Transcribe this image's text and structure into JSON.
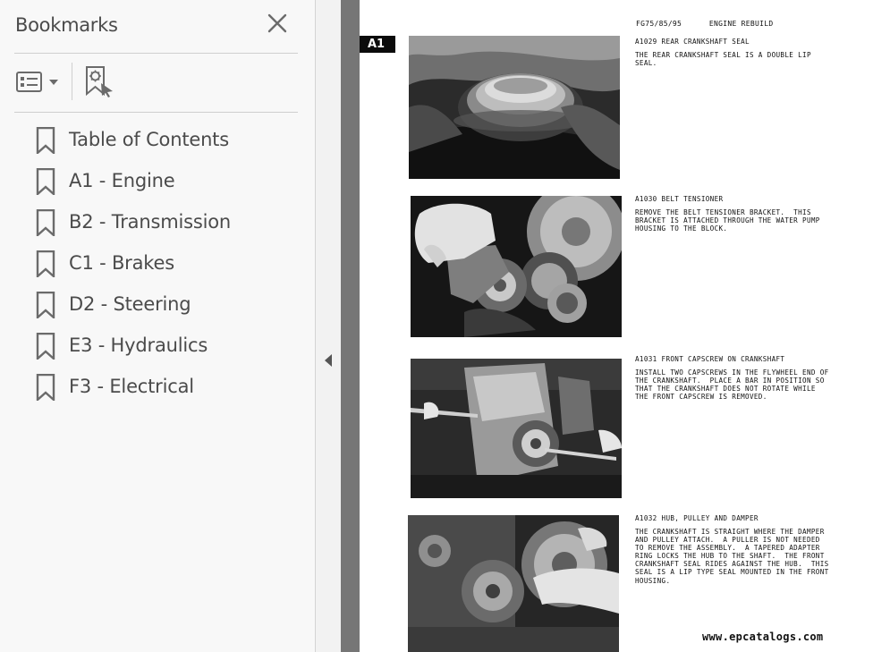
{
  "sidebar": {
    "title": "Bookmarks",
    "items": [
      {
        "label": "Table of Contents"
      },
      {
        "label": "A1 - Engine"
      },
      {
        "label": "B2 - Transmission"
      },
      {
        "label": "C1 - Brakes"
      },
      {
        "label": "D2 - Steering"
      },
      {
        "label": "E3 - Hydraulics"
      },
      {
        "label": "F3 - Electrical"
      }
    ]
  },
  "icons": {
    "close": "close-icon",
    "options": "list-options-icon",
    "new_bookmark": "add-bookmark-icon",
    "bookmark": "bookmark-icon",
    "collapse": "collapse-arrow-icon"
  },
  "document": {
    "header": "FG75/85/95      ENGINE REBUILD",
    "section_tab": "A1",
    "entries": [
      {
        "title": "A1029   REAR CRANKSHAFT SEAL",
        "body": "THE REAR CRANKSHAFT SEAL IS A DOUBLE LIP\nSEAL."
      },
      {
        "title": "A1030   BELT TENSIONER",
        "body": "REMOVE THE BELT TENSIONER BRACKET.  THIS\nBRACKET IS ATTACHED THROUGH THE WATER PUMP\nHOUSING TO THE BLOCK."
      },
      {
        "title": "A1031   FRONT CAPSCREW ON CRANKSHAFT",
        "body": "INSTALL TWO CAPSCREWS IN THE FLYWHEEL END OF\nTHE CRANKSHAFT.  PLACE A BAR IN POSITION SO\nTHAT THE CRANKSHAFT DOES NOT ROTATE WHILE\nTHE FRONT CAPSCREW IS REMOVED."
      },
      {
        "title": "A1032   HUB, PULLEY AND DAMPER",
        "body": "THE CRANKSHAFT IS STRAIGHT WHERE THE DAMPER\nAND PULLEY ATTACH.  A PULLER IS NOT NEEDED\nTO REMOVE THE ASSEMBLY.  A TAPERED ADAPTER\nRING LOCKS THE HUB TO THE SHAFT.  THE FRONT\nCRANKSHAFT SEAL RIDES AGAINST THE HUB.  THIS\nSEAL IS A LIP TYPE SEAL MOUNTED IN THE FRONT\nHOUSING."
      }
    ],
    "watermark": "www.epcatalogs.com"
  },
  "colors": {
    "sidebar_bg": "#f8f8f8",
    "text": "#4b4b4b",
    "icon": "#6b6b6b",
    "doc_bg": "#6e6e6e"
  }
}
